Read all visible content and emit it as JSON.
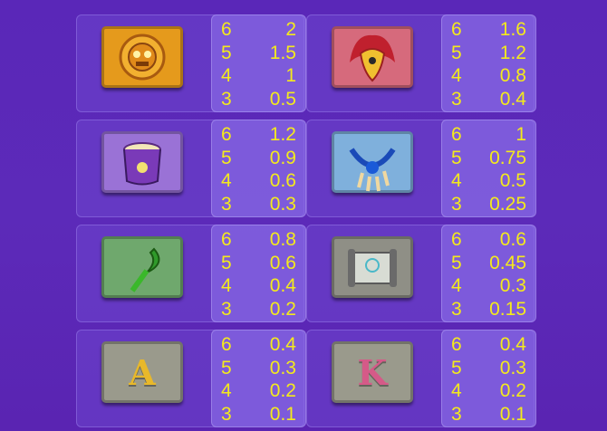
{
  "symbols": [
    {
      "icon": "golden-sun-mask-icon",
      "tile_color": "#e59a1c",
      "pays": [
        {
          "count": "6",
          "value": "2"
        },
        {
          "count": "5",
          "value": "1.5"
        },
        {
          "count": "4",
          "value": "1"
        },
        {
          "count": "3",
          "value": "0.5"
        }
      ]
    },
    {
      "icon": "feathered-bird-mask-icon",
      "tile_color": "#d66a7c",
      "pays": [
        {
          "count": "6",
          "value": "1.6"
        },
        {
          "count": "5",
          "value": "1.2"
        },
        {
          "count": "4",
          "value": "0.8"
        },
        {
          "count": "3",
          "value": "0.4"
        }
      ]
    },
    {
      "icon": "purple-drum-icon",
      "tile_color": "#9a72d6",
      "pays": [
        {
          "count": "6",
          "value": "1.2"
        },
        {
          "count": "5",
          "value": "0.9"
        },
        {
          "count": "4",
          "value": "0.6"
        },
        {
          "count": "3",
          "value": "0.3"
        }
      ]
    },
    {
      "icon": "claw-necklace-icon",
      "tile_color": "#7fb0dc",
      "pays": [
        {
          "count": "6",
          "value": "1"
        },
        {
          "count": "5",
          "value": "0.75"
        },
        {
          "count": "4",
          "value": "0.5"
        },
        {
          "count": "3",
          "value": "0.25"
        }
      ]
    },
    {
      "icon": "jade-sickle-icon",
      "tile_color": "#6fa86d",
      "pays": [
        {
          "count": "6",
          "value": "0.8"
        },
        {
          "count": "5",
          "value": "0.6"
        },
        {
          "count": "4",
          "value": "0.4"
        },
        {
          "count": "3",
          "value": "0.2"
        }
      ]
    },
    {
      "icon": "stone-scroll-icon",
      "tile_color": "#8f8f86",
      "pays": [
        {
          "count": "6",
          "value": "0.6"
        },
        {
          "count": "5",
          "value": "0.45"
        },
        {
          "count": "4",
          "value": "0.3"
        },
        {
          "count": "3",
          "value": "0.15"
        }
      ]
    },
    {
      "icon": "letter-a-icon",
      "letter": "A",
      "tile_color": "#9a9a8c",
      "letter_color": "#e8b82a",
      "pays": [
        {
          "count": "6",
          "value": "0.4"
        },
        {
          "count": "5",
          "value": "0.3"
        },
        {
          "count": "4",
          "value": "0.2"
        },
        {
          "count": "3",
          "value": "0.1"
        }
      ]
    },
    {
      "icon": "letter-k-icon",
      "letter": "K",
      "tile_color": "#9a9a8c",
      "letter_color": "#d55a88",
      "pays": [
        {
          "count": "6",
          "value": "0.4"
        },
        {
          "count": "5",
          "value": "0.3"
        },
        {
          "count": "4",
          "value": "0.2"
        },
        {
          "count": "3",
          "value": "0.1"
        }
      ]
    }
  ]
}
